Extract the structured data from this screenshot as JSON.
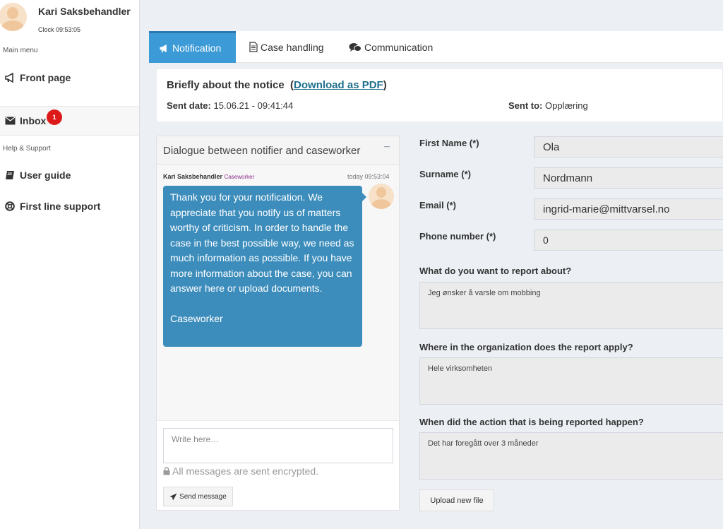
{
  "user": {
    "name": "Kari Saksbehandler",
    "clock": "Clock 09:53:05"
  },
  "sidebar": {
    "main_menu_header": "Main menu",
    "help_header": "Help & Support",
    "items": [
      {
        "label": "Front page",
        "icon": "bullhorn-icon"
      },
      {
        "label": "Inbox",
        "icon": "envelope-icon",
        "badge": "1"
      },
      {
        "label": "User guide",
        "icon": "book-icon"
      },
      {
        "label": "First line support",
        "icon": "life-ring-icon"
      }
    ]
  },
  "tabs": [
    {
      "label": "Notification",
      "icon": "bullhorn-icon",
      "active": true
    },
    {
      "label": "Case handling",
      "icon": "file-text-icon"
    },
    {
      "label": "Communication",
      "icon": "comments-icon"
    }
  ],
  "notice": {
    "title": "Briefly about the notice",
    "open_paren": "(",
    "download_link": "Download as PDF",
    "close_paren": ")",
    "sent_date_label": "Sent date:",
    "sent_date_value": "15.06.21 - 09:41:44",
    "sent_to_label": "Sent to:",
    "sent_to_value": "Opplæring"
  },
  "dialogue": {
    "title": "Dialogue between notifier and caseworker",
    "collapse_label": "−",
    "message": {
      "author": "Kari Saksbehandler",
      "role": "Caseworker",
      "time": "today 09:53:04",
      "text": "Thank you for your notification. We appreciate that you notify us of matters worthy of criticism. In order to handle the case in the best possible way, we need as much information as possible. If you have more information about the case, you can answer here or upload documents.\n\nCaseworker"
    },
    "input_placeholder": "Write here…",
    "encrypted_note": "All messages are sent encrypted.",
    "send_button": "Send message"
  },
  "form": {
    "first_name_label": "First Name (*)",
    "first_name_value": "Ola",
    "surname_label": "Surname (*)",
    "surname_value": "Nordmann",
    "email_label": "Email (*)",
    "email_value": "ingrid-marie@mittvarsel.no",
    "phone_label": "Phone number (*)",
    "phone_value": "0",
    "report_about_label": "What do you want to report about?",
    "report_about_value": "Jeg ønsker å varsle om mobbing",
    "where_label": "Where in the organization does the report apply?",
    "where_value": "Hele virksomheten",
    "when_label": "When did the action that is being reported happen?",
    "when_value": "Det har foregått over 3 måneder",
    "upload_button": "Upload new file"
  },
  "colors": {
    "accent": "#3c8dbc",
    "tab_active": "#3c9ad6",
    "badge": "#dd1a1a",
    "link": "#1e6f8c"
  }
}
